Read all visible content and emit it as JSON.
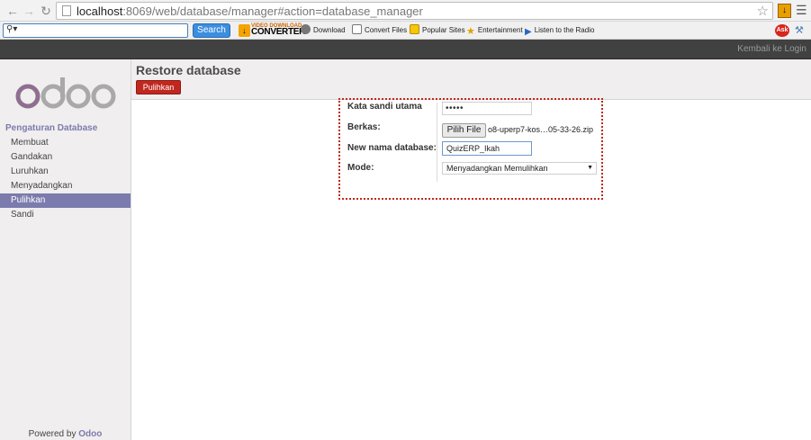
{
  "browser": {
    "url_host": "localhost",
    "url_path": ":8069/web/database/manager#action=database_manager"
  },
  "toolbar": {
    "search_button": "Search",
    "vdc_top": "VIDEO DOWNLOAD",
    "vdc_main": "CONVERTER",
    "items": {
      "download": "Download",
      "convert": "Convert Files",
      "popular": "Popular Sites",
      "entertainment": "Entertainment",
      "radio": "Listen to the Radio"
    },
    "ask": "Ask"
  },
  "topbar": {
    "back_link": "Kembali ke Login"
  },
  "sidebar": {
    "logo": "odoo",
    "title": "Pengaturan Database",
    "items": [
      {
        "label": "Membuat"
      },
      {
        "label": "Gandakan"
      },
      {
        "label": "Luruhkan"
      },
      {
        "label": "Menyadangkan"
      },
      {
        "label": "Pulihkan"
      },
      {
        "label": "Sandi"
      }
    ],
    "active_index": 4,
    "powered_prefix": "Powered by ",
    "powered_brand": "Odoo"
  },
  "main": {
    "title": "Restore database",
    "restore_button": "Pulihkan",
    "form": {
      "master_password_label": "Kata sandi utama",
      "master_password_value": "•••••",
      "file_label": "Berkas:",
      "file_button": "Pilih File",
      "file_name": "o8-uperp7-kos…05-33-26.zip",
      "db_name_label": "New nama database:",
      "db_name_value": "QuizERP_Ikah",
      "mode_label": "Mode:",
      "mode_value": "Menyadangkan Memulihkan"
    }
  },
  "colors": {
    "odoo_purple": "#7c7bad",
    "restore_red": "#c0281f",
    "topbar_dark": "#414141"
  }
}
